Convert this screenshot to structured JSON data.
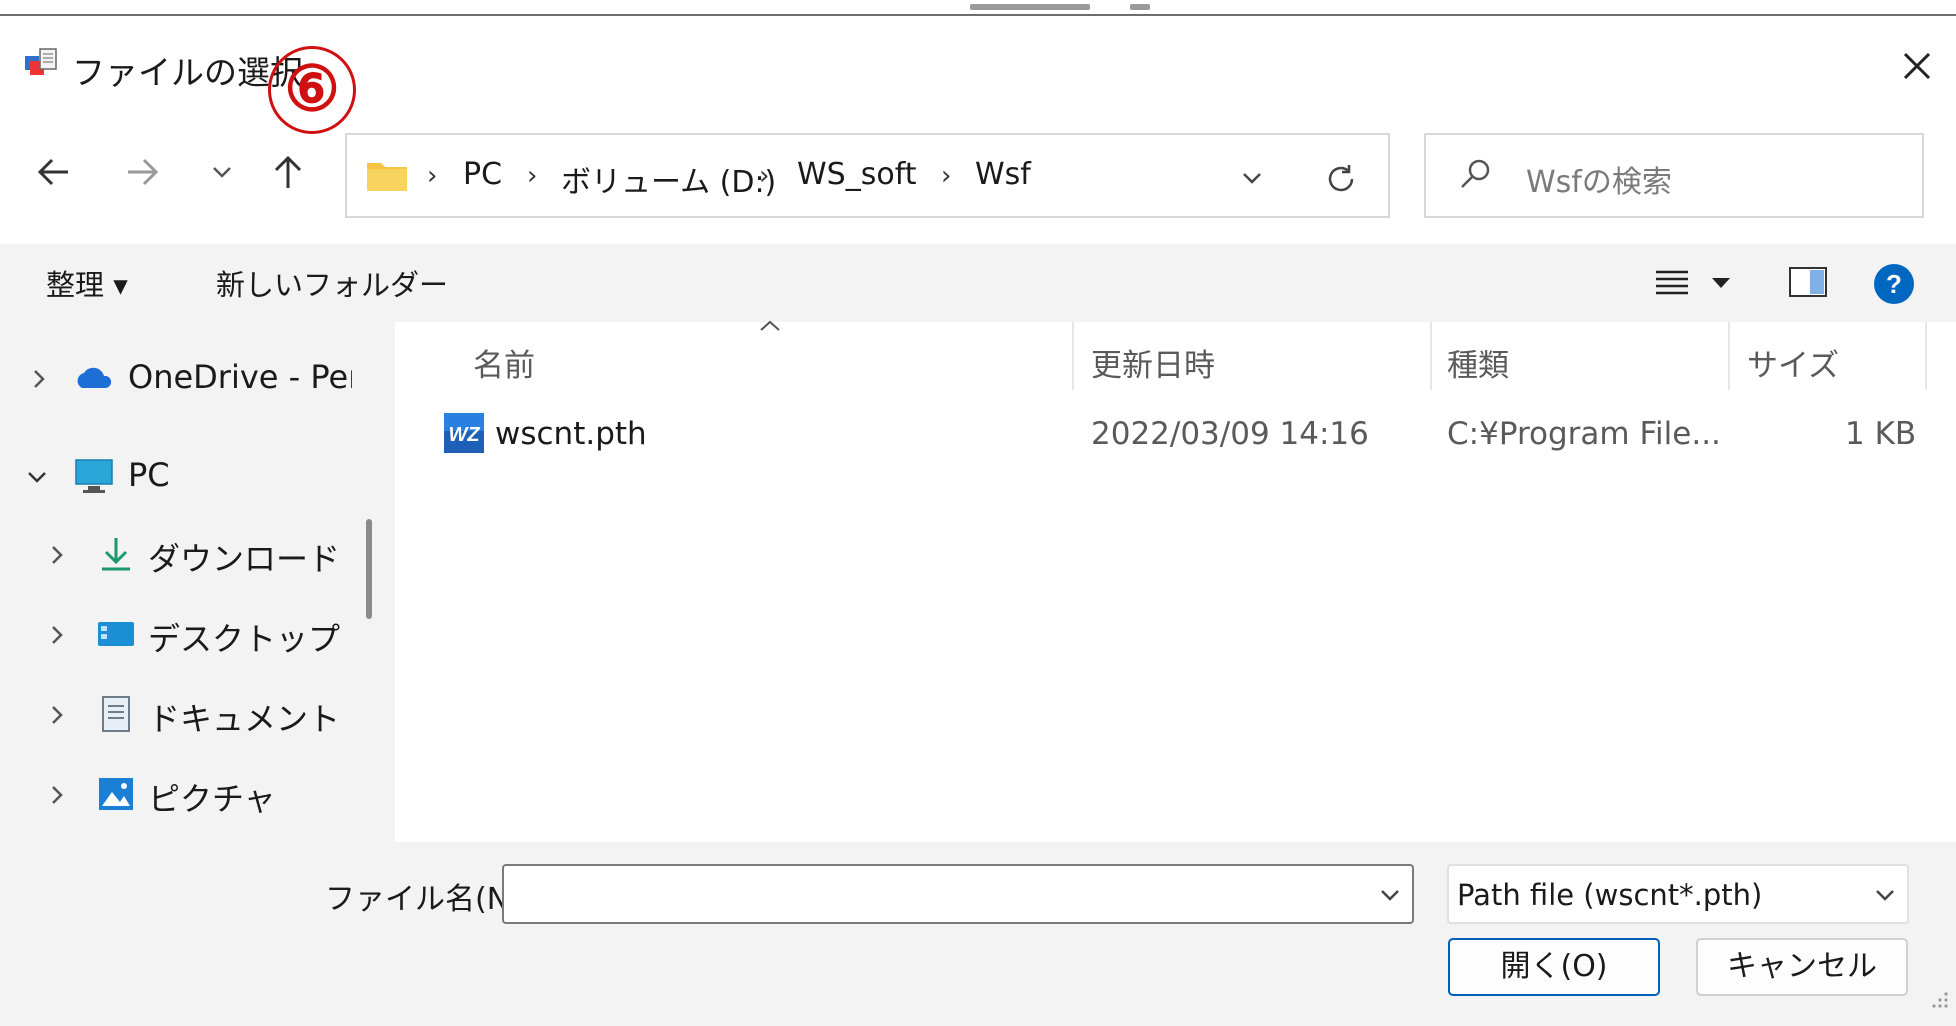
{
  "window": {
    "title": "ファイルの選択",
    "step_badge": "⑥"
  },
  "nav": {
    "breadcrumbs": [
      "PC",
      "ボリューム (D:)",
      "WS_soft",
      "Wsf"
    ],
    "search_placeholder": "Wsfの検索"
  },
  "toolbar": {
    "organize_label": "整理 ▾",
    "new_folder_label": "新しいフォルダー"
  },
  "nav_pane": {
    "items": [
      {
        "label": "OneDrive - Per:",
        "icon": "cloud-icon"
      },
      {
        "label": "PC",
        "icon": "monitor-icon"
      },
      {
        "label": "ダウンロード",
        "icon": "download-icon"
      },
      {
        "label": "デスクトップ",
        "icon": "desktop-icon"
      },
      {
        "label": "ドキュメント",
        "icon": "document-icon"
      },
      {
        "label": "ピクチャ",
        "icon": "picture-icon"
      }
    ]
  },
  "file_list": {
    "columns": [
      "名前",
      "更新日時",
      "種類",
      "サイズ"
    ],
    "rows": [
      {
        "name": "wscnt.pth",
        "modified": "2022/03/09 14:16",
        "type": "C:¥Program File...",
        "size": "1 KB",
        "icon": "wz-app-icon"
      }
    ]
  },
  "footer": {
    "filename_label": "ファイル名(N):",
    "filename_value": "",
    "filter_value": "Path file (wscnt*.pth)",
    "open_label": "開く(O)",
    "cancel_label": "キャンセル"
  },
  "colors": {
    "accent": "#005fb8",
    "pane_bg": "#f3f3f3",
    "badge": "#d01010",
    "help": "#0067c0",
    "folder": "#f6c344"
  }
}
